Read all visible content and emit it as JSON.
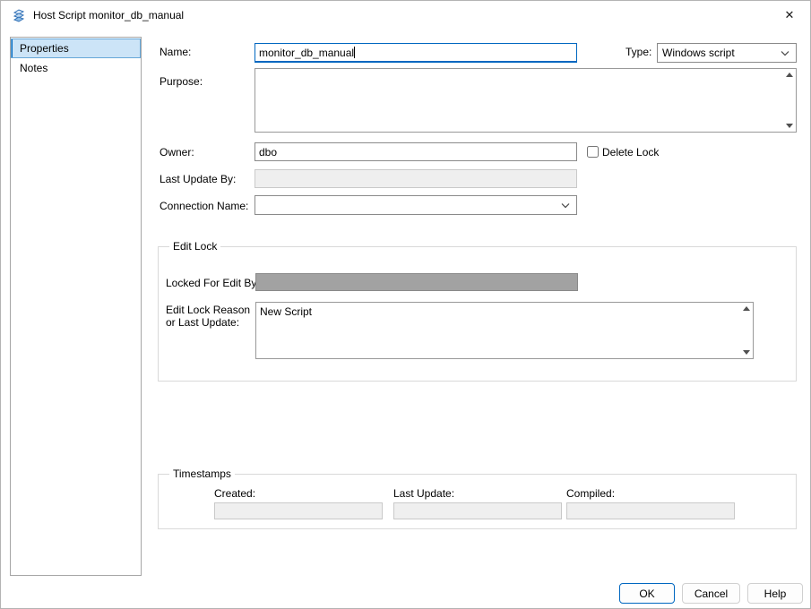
{
  "window": {
    "title": "Host Script monitor_db_manual",
    "close_glyph": "✕"
  },
  "sidebar": {
    "items": [
      {
        "label": "Properties",
        "selected": true
      },
      {
        "label": "Notes",
        "selected": false
      }
    ]
  },
  "fields": {
    "name": {
      "label": "Name:",
      "value": "monitor_db_manual"
    },
    "type": {
      "label": "Type:",
      "value": "Windows script"
    },
    "purpose": {
      "label": "Purpose:",
      "value": ""
    },
    "owner": {
      "label": "Owner:",
      "value": "dbo"
    },
    "delete_lock": {
      "label": "Delete Lock",
      "checked": false
    },
    "last_update_by": {
      "label": "Last Update By:",
      "value": ""
    },
    "connection_name": {
      "label": "Connection Name:",
      "value": ""
    }
  },
  "edit_lock_group": {
    "title": "Edit Lock",
    "locked_for_edit_by": {
      "label": "Locked For Edit By:",
      "value": ""
    },
    "reason": {
      "label_line1": "Edit Lock Reason",
      "label_line2": "or Last Update:",
      "value": "New Script"
    }
  },
  "timestamps_group": {
    "title": "Timestamps",
    "created": {
      "label": "Created:",
      "value": ""
    },
    "last_update": {
      "label": "Last Update:",
      "value": ""
    },
    "compiled": {
      "label": "Compiled:",
      "value": ""
    }
  },
  "buttons": {
    "ok": "OK",
    "cancel": "Cancel",
    "help": "Help"
  },
  "colors": {
    "accent": "#0067c0",
    "selection_bg": "#cce4f7",
    "locked_fill": "#a2a2a2",
    "disabled_bg": "#efefef"
  }
}
